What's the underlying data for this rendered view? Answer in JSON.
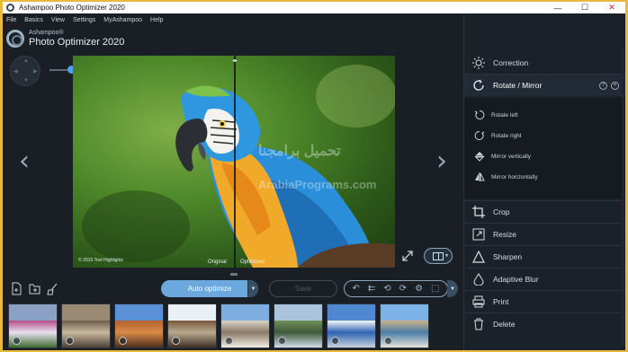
{
  "window": {
    "title": "Ashampoo Photo Optimizer 2020",
    "minimize": "—",
    "maximize": "☐",
    "close": "✕"
  },
  "menu": [
    "File",
    "Basics",
    "View",
    "Settings",
    "MyAshampoo",
    "Help"
  ],
  "logo": {
    "brand": "Ashampoo®",
    "product": "Photo Optimizer 2020"
  },
  "viewer": {
    "label_original": "Original",
    "label_optimized": "Optimized",
    "photo_copyright": "© 2019 Tool Highlights",
    "watermark_line1": "تحميل برامجنا",
    "watermark_line2": "ArabiaPrograms.com"
  },
  "toolbar": {
    "auto_optimize": "Auto optimize",
    "save": "Save"
  },
  "panel": {
    "correction": "Correction",
    "rotate_mirror": "Rotate / Mirror",
    "help_symbol": "?",
    "close_symbol": "×",
    "sub_items": [
      "Rotate left",
      "Rotate right",
      "Mirror vertically",
      "Mirror horizontally"
    ],
    "tools": [
      "Crop",
      "Resize",
      "Sharpen",
      "Adaptive Blur",
      "Print",
      "Delete"
    ]
  },
  "thumbnails": [
    {
      "name": "flowers",
      "colors": [
        "#8aa0c4",
        "#b64f8a",
        "#e7e0ef",
        "#3f6a2f"
      ]
    },
    {
      "name": "monkeys",
      "colors": [
        "#9a8a74",
        "#6d5e4c",
        "#c9b8a0",
        "#4a4034"
      ]
    },
    {
      "name": "canyon",
      "colors": [
        "#5b8fd6",
        "#b3622f",
        "#d98a48",
        "#4a2e1c"
      ]
    },
    {
      "name": "camels",
      "colors": [
        "#e9f0f6",
        "#7a5a3c",
        "#b9a88e",
        "#3e2e22"
      ]
    },
    {
      "name": "village",
      "colors": [
        "#7eaee0",
        "#d8d2c6",
        "#8a7a66",
        "#f3efe8"
      ]
    },
    {
      "name": "lake",
      "colors": [
        "#a9c4dc",
        "#6f8f5a",
        "#3e5a3a",
        "#d2dde6"
      ]
    },
    {
      "name": "church",
      "colors": [
        "#4f88d0",
        "#f4f6f8",
        "#2e63b4",
        "#c9d3dd"
      ]
    },
    {
      "name": "coast",
      "colors": [
        "#7db3e6",
        "#c8b08a",
        "#4b7ea8",
        "#e6e2d8"
      ]
    }
  ]
}
